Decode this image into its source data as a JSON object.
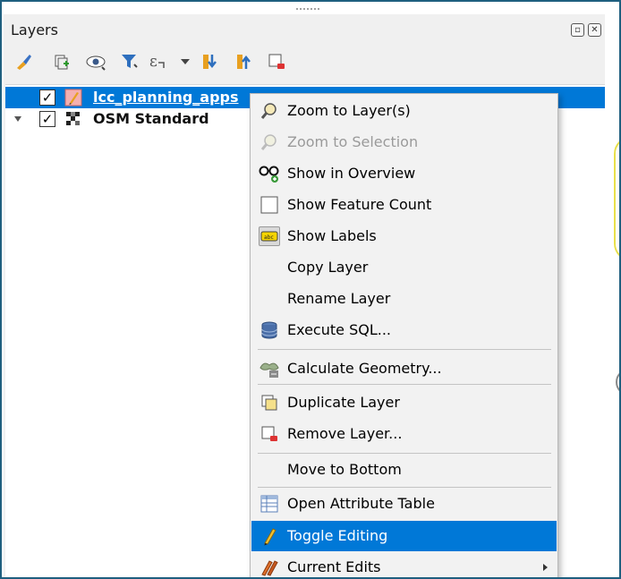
{
  "panel": {
    "title": "Layers",
    "float_icon": "float-icon",
    "close_icon": "close-icon"
  },
  "toolbar": {
    "icons": [
      "style-brush-icon",
      "add-group-icon",
      "eye-icon",
      "filter-icon",
      "expression-filter-icon",
      "dropdown-arrow-icon",
      "expand-all-icon",
      "collapse-all-icon",
      "remove-layer-icon"
    ]
  },
  "layers": [
    {
      "label": "lcc_planning_apps",
      "checked": "✓",
      "icon": "pencil-layer-icon",
      "selected": true
    },
    {
      "label": "OSM Standard",
      "checked": "✓",
      "icon": "raster-tile-icon",
      "selected": false
    }
  ],
  "menu": {
    "items": [
      {
        "label": "Zoom to Layer(s)",
        "icon": "zoom-layer-icon",
        "enabled": true
      },
      {
        "label": "Zoom to Selection",
        "icon": "zoom-selection-icon",
        "enabled": false
      },
      {
        "label": "Show in Overview",
        "icon": "glasses-icon",
        "enabled": true
      },
      {
        "label": "Show Feature Count",
        "icon": "checkbox-icon",
        "enabled": true
      },
      {
        "label": "Show Labels",
        "icon": "labels-icon",
        "enabled": true
      },
      {
        "label": "Copy Layer",
        "icon": "",
        "enabled": true
      },
      {
        "label": "Rename Layer",
        "icon": "",
        "enabled": true
      },
      {
        "label": "Execute SQL...",
        "icon": "database-icon",
        "enabled": true
      },
      {
        "label": "Calculate Geometry...",
        "icon": "calculate-geometry-icon",
        "enabled": true
      },
      {
        "label": "Duplicate Layer",
        "icon": "duplicate-layer-icon",
        "enabled": true
      },
      {
        "label": "Remove Layer...",
        "icon": "remove-layer-icon",
        "enabled": true
      },
      {
        "label": "Move to Bottom",
        "icon": "",
        "enabled": true
      },
      {
        "label": "Open Attribute Table",
        "icon": "table-icon",
        "enabled": true
      },
      {
        "label": "Toggle Editing",
        "icon": "pencil-icon",
        "enabled": true,
        "highlighted": true
      },
      {
        "label": "Current Edits",
        "icon": "current-edits-icon",
        "enabled": true,
        "submenu": true
      }
    ]
  },
  "colors": {
    "selection": "#0078d7",
    "menu_bg": "#f2f2f2",
    "frame_border": "#1f5f7f"
  }
}
